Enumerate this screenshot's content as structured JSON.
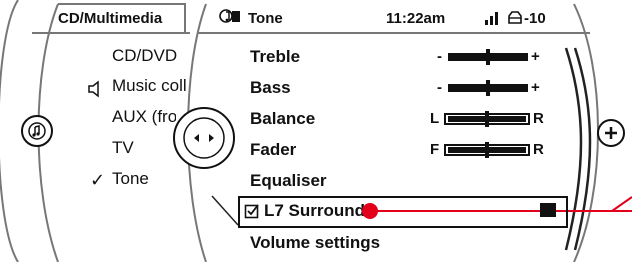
{
  "left_panel": {
    "title": "CD/Multimedia",
    "items": [
      {
        "label": "CD/DVD",
        "icon": null,
        "checked": false
      },
      {
        "label": "Music colle",
        "icon": "speaker-icon",
        "checked": false
      },
      {
        "label": "AUX (fro",
        "icon": null,
        "checked": false
      },
      {
        "label": "TV",
        "icon": null,
        "checked": false
      },
      {
        "label": "Tone",
        "icon": "check-icon",
        "checked": true
      }
    ]
  },
  "header": {
    "title": "Tone",
    "title_icon": "music-note-icon",
    "time": "11:22am",
    "signal_icon": "signal-strength-icon",
    "temp_icon": "car-temp-icon",
    "temp_value": "-10"
  },
  "menu": {
    "items": [
      {
        "label": "Treble",
        "type": "slider",
        "left": "-",
        "right": "+",
        "level": 0.5
      },
      {
        "label": "Bass",
        "type": "slider",
        "left": "-",
        "right": "+",
        "level": 0.5
      },
      {
        "label": "Balance",
        "type": "slider",
        "left": "L",
        "right": "R",
        "level": 0.5
      },
      {
        "label": "Fader",
        "type": "slider",
        "left": "F",
        "right": "R",
        "level": 0.5
      },
      {
        "label": "Equaliser",
        "type": "text"
      },
      {
        "label": "L7 Surround",
        "type": "checkbox",
        "selected": true
      },
      {
        "label": "Volume settings",
        "type": "text"
      }
    ]
  },
  "controller": {
    "left_button_icon": "music-note-icon",
    "right_button_icon": "plus-icon",
    "center_knob_icon": "controller-arrows-icon"
  },
  "colors": {
    "accent_red": "#e3001b",
    "bg": "#ffffff",
    "fg": "#111111"
  }
}
